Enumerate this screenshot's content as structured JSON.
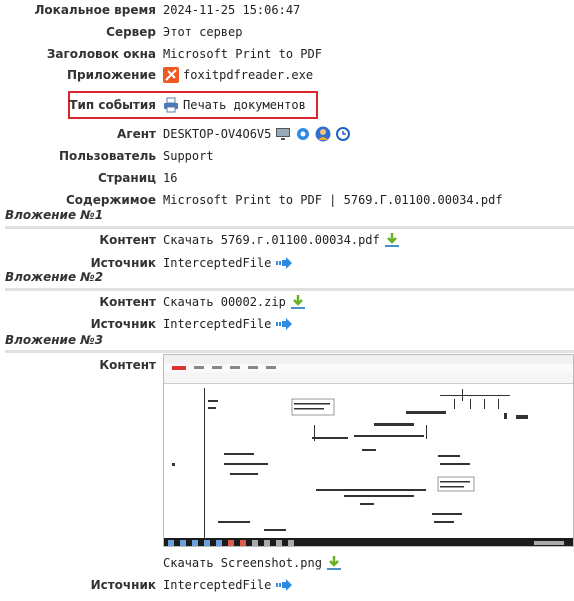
{
  "fields": {
    "local_time": {
      "label": "Локальное время",
      "value": "2024-11-25 15:06:47"
    },
    "server": {
      "label": "Сервер",
      "value": "Этот сервер"
    },
    "window_title": {
      "label": "Заголовок окна",
      "value": "Microsoft Print to PDF"
    },
    "application": {
      "label": "Приложение",
      "value": "foxitpdfreader.exe"
    },
    "event_type": {
      "label": "Тип события",
      "value": "Печать документов"
    },
    "agent": {
      "label": "Агент",
      "value": "DESKTOP-OV4O6V5"
    },
    "user": {
      "label": "Пользователь",
      "value": "Support"
    },
    "pages": {
      "label": "Страниц",
      "value": "16"
    },
    "contents": {
      "label": "Содержимое",
      "value": "Microsoft Print to PDF | 5769.Г.01100.00034.pdf"
    }
  },
  "attachments": [
    {
      "title": "Вложение №1",
      "content_label": "Контент",
      "content_value": "Скачать 5769.г.01100.00034.pdf",
      "source_label": "Источник",
      "source_value": "InterceptedFile"
    },
    {
      "title": "Вложение №2",
      "content_label": "Контент",
      "content_value": "Скачать 00002.zip",
      "source_label": "Источник",
      "source_value": "InterceptedFile"
    },
    {
      "title": "Вложение №3",
      "content_label": "Контент",
      "content_value": "Скачать Screenshot.png",
      "source_label": "Источник",
      "source_value": "InterceptedFile"
    }
  ],
  "icons": {
    "app": "foxit-app-icon",
    "event": "printer-icon",
    "agent": [
      "monitor-icon",
      "gear-icon",
      "user-avatar-icon",
      "clock-icon"
    ],
    "download": "download-icon",
    "source": "arrow-right-icon"
  },
  "colors": {
    "highlight": "#d9262c",
    "download": "#6ab023",
    "arrow": "#2f8be0",
    "foxit": "#f05a22"
  }
}
